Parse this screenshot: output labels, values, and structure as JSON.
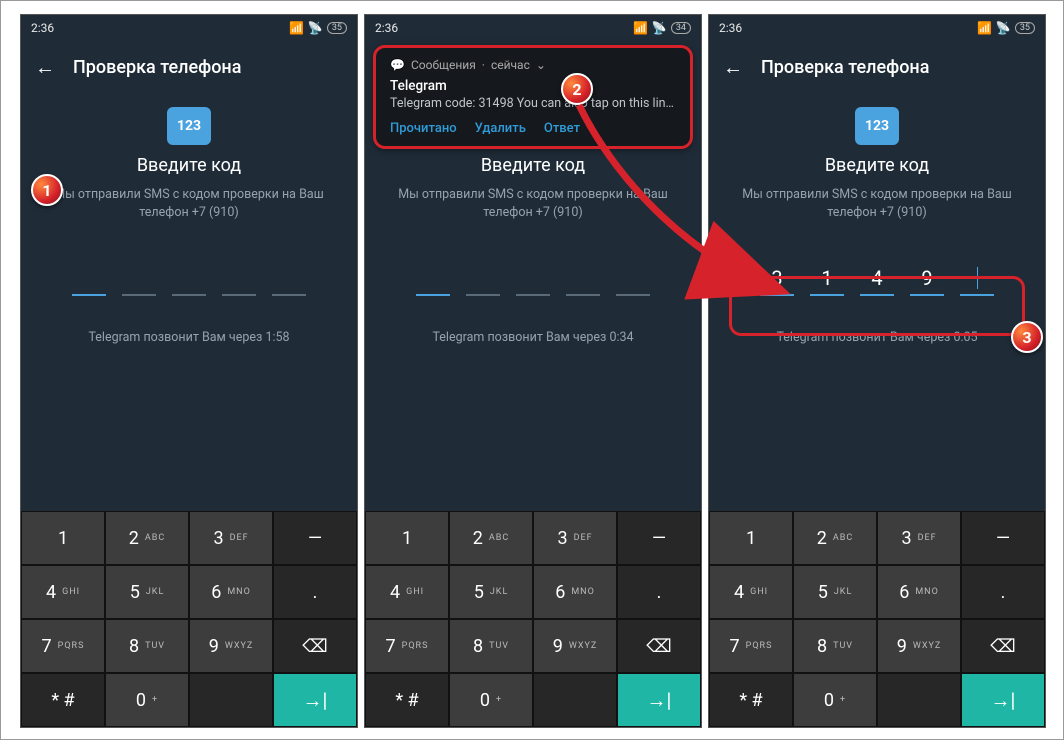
{
  "status": {
    "time": "2:36",
    "battery1": "35",
    "battery2": "34",
    "battery3": "35"
  },
  "header": {
    "title": "Проверка телефона"
  },
  "content": {
    "bubble": "123",
    "enter": "Введите код",
    "desc_line1": "Мы отправили SMS с кодом проверки на Ваш",
    "desc_line2": "телефон +7 (910)"
  },
  "callbacks": {
    "p1": "Telegram позвонит Вам через 1:58",
    "p2": "Telegram позвонит Вам через 0:34",
    "p3": "Telegram позвонит Вам через 0:05"
  },
  "code_entered": [
    "3",
    "1",
    "4",
    "9",
    ""
  ],
  "keypad": {
    "k1": "1",
    "k2": "2",
    "k3": "3",
    "k4": "4",
    "k5": "5",
    "k6": "6",
    "k7": "7",
    "k8": "8",
    "k9": "9",
    "k0": "0",
    "sub2": "ABC",
    "sub3": "DEF",
    "sub4": "GHI",
    "sub5": "JKL",
    "sub6": "MNO",
    "sub7": "PQRS",
    "sub8": "TUV",
    "sub9": "WXYZ",
    "sub0": "+",
    "dash": "—",
    "star": "* #",
    "period": ".",
    "enter": "→|"
  },
  "notif": {
    "source": "Сообщения",
    "when": "сейчас",
    "app": "Telegram",
    "body": "Telegram code: 31498  You can also tap on this link ..",
    "a1": "Прочитано",
    "a2": "Удалить",
    "a3": "Ответ"
  },
  "badges": {
    "b1": "1",
    "b2": "2",
    "b3": "3"
  }
}
